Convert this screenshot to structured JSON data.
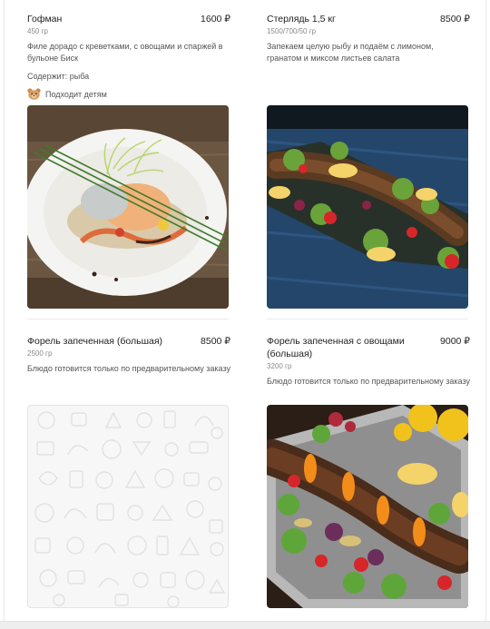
{
  "items": [
    {
      "name": "Гофман",
      "price": "1600 ₽",
      "weight": "450 гр",
      "description": "Филе дорадо с креветками, с овощами и спаржей в бульоне Биск",
      "contains": "Содержит: рыба",
      "kids_label": "Подходит детям",
      "image_icon": "dish-photo-icon"
    },
    {
      "name": "Стерлядь 1,5 кг",
      "price": "8500 ₽",
      "weight": "1500/700/50 гр",
      "description": "Запекаем целую рыбу и подаём с лимоном, гранатом и миксом листьев салата",
      "image_icon": "dish-photo-icon"
    },
    {
      "name": "Форель запеченная (большая)",
      "price": "8500 ₽",
      "weight": "2500 гр",
      "description": "Блюдо готовится только по предварительному заказу",
      "image_icon": "food-pattern-placeholder-icon"
    },
    {
      "name": "Форель запеченная с овощами (большая)",
      "price": "9000 ₽",
      "weight": "3200 гр",
      "description": "Блюдо готовится только по предварительному заказу",
      "image_icon": "dish-photo-icon"
    }
  ],
  "colors": {
    "text": "#1f1f1f",
    "muted": "#8a8a8a",
    "bear": "#d9a063"
  }
}
